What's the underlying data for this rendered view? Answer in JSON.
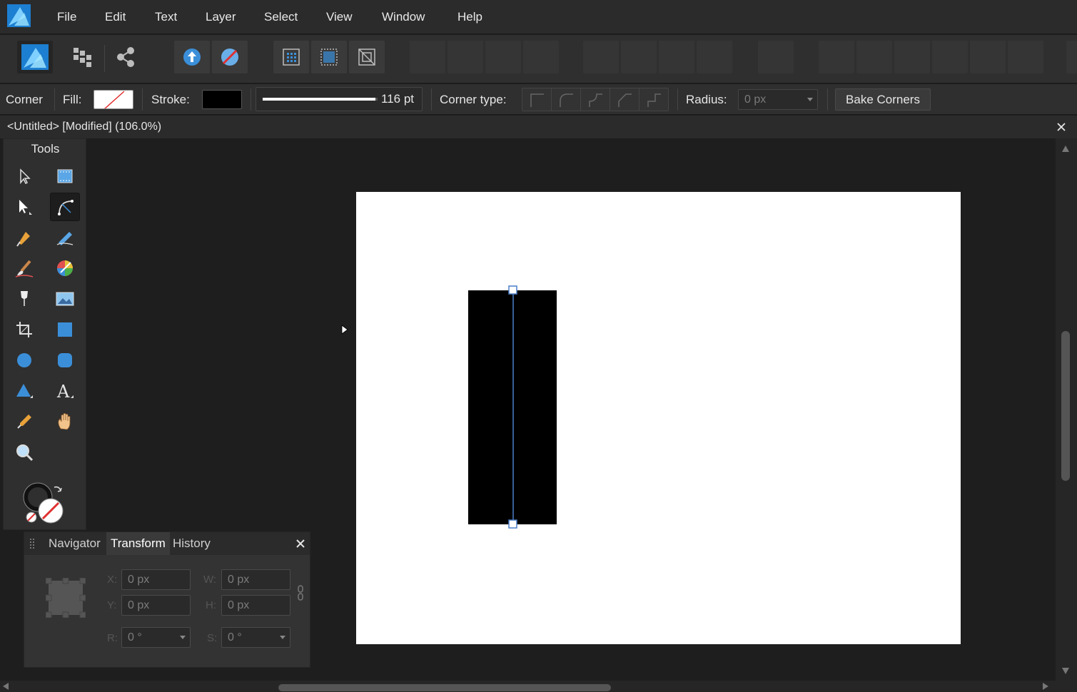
{
  "menu": {
    "items": [
      "File",
      "Edit",
      "Text",
      "Layer",
      "Select",
      "View",
      "Window",
      "Help"
    ]
  },
  "context_bar": {
    "tool_name": "Corner",
    "fill_label": "Fill:",
    "stroke_label": "Stroke:",
    "stroke_width": "116 pt",
    "stroke_width_fraction": 0.98,
    "corner_type_label": "Corner type:",
    "radius_label": "Radius:",
    "radius_value": "0 px",
    "bake_corners_label": "Bake Corners"
  },
  "document": {
    "title": "<Untitled> [Modified] (106.0%)"
  },
  "tools_panel": {
    "title": "Tools"
  },
  "transform_panel": {
    "tabs": [
      "Navigator",
      "Transform",
      "History"
    ],
    "active_tab": "Transform",
    "x_label": "X:",
    "x_value": "0 px",
    "y_label": "Y:",
    "y_value": "0 px",
    "w_label": "W:",
    "w_value": "0 px",
    "h_label": "H:",
    "h_value": "0 px",
    "r_label": "R:",
    "r_value": "0 °",
    "s_label": "S:",
    "s_value": "0 °"
  },
  "colors": {
    "accent": "#3b8fd9",
    "stroke_color": "#000000",
    "fill_none_slash": "#e03030",
    "selection_line": "#4a7fc8"
  },
  "icons": {
    "app_logo": "affinity-designer-logo",
    "close": "close-icon"
  }
}
